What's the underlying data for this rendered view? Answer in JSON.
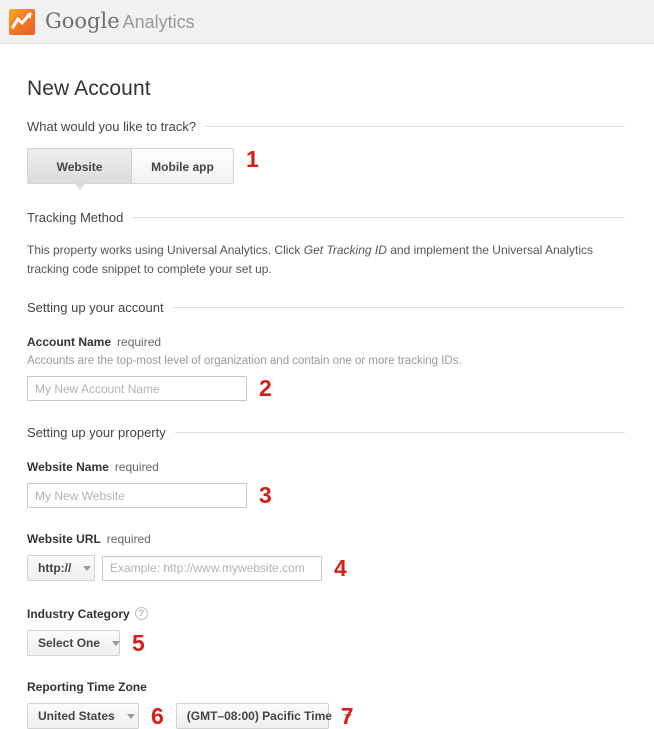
{
  "header": {
    "logo_icon": "google-analytics-logo-icon",
    "brand_primary": "Google",
    "brand_secondary": "Analytics",
    "bg_color": "#f1f1f1"
  },
  "page": {
    "title": "New Account"
  },
  "track_section": {
    "heading": "What would you like to track?",
    "tabs": [
      {
        "label": "Website",
        "selected": true
      },
      {
        "label": "Mobile app",
        "selected": false
      }
    ],
    "marker": "1"
  },
  "tracking_method": {
    "heading": "Tracking Method",
    "paragraph_part1": "This property works using Universal Analytics. Click ",
    "paragraph_emphasis": "Get Tracking ID",
    "paragraph_part2": " and implement the Universal Analytics tracking code snippet to complete your set up."
  },
  "account_section": {
    "heading": "Setting up your account",
    "account_name_label": "Account Name",
    "account_name_required": "required",
    "account_name_help": "Accounts are the top-most level of organization and contain one or more tracking IDs.",
    "account_name_value": "",
    "account_name_placeholder": "My New Account Name",
    "marker": "2"
  },
  "property_section": {
    "heading": "Setting up your property",
    "website_name_label": "Website Name",
    "website_name_required": "required",
    "website_name_value": "",
    "website_name_placeholder": "My New Website",
    "website_name_marker": "3",
    "website_url_label": "Website URL",
    "website_url_required": "required",
    "protocol_value": "http://",
    "website_url_value": "",
    "website_url_placeholder": "Example: http://www.mywebsite.com",
    "website_url_marker": "4",
    "industry_label": "Industry Category",
    "industry_help_icon": "question-mark-help-icon",
    "industry_value": "Select One",
    "industry_marker": "5",
    "timezone_label": "Reporting Time Zone",
    "timezone_country_value": "United States",
    "timezone_country_marker": "6",
    "timezone_value": "(GMT–08:00) Pacific Time",
    "timezone_marker": "7"
  },
  "colors": {
    "marker_red": "#d61f16",
    "focus_blue": "#5b87d6",
    "logo_orange": "#f57c20"
  }
}
